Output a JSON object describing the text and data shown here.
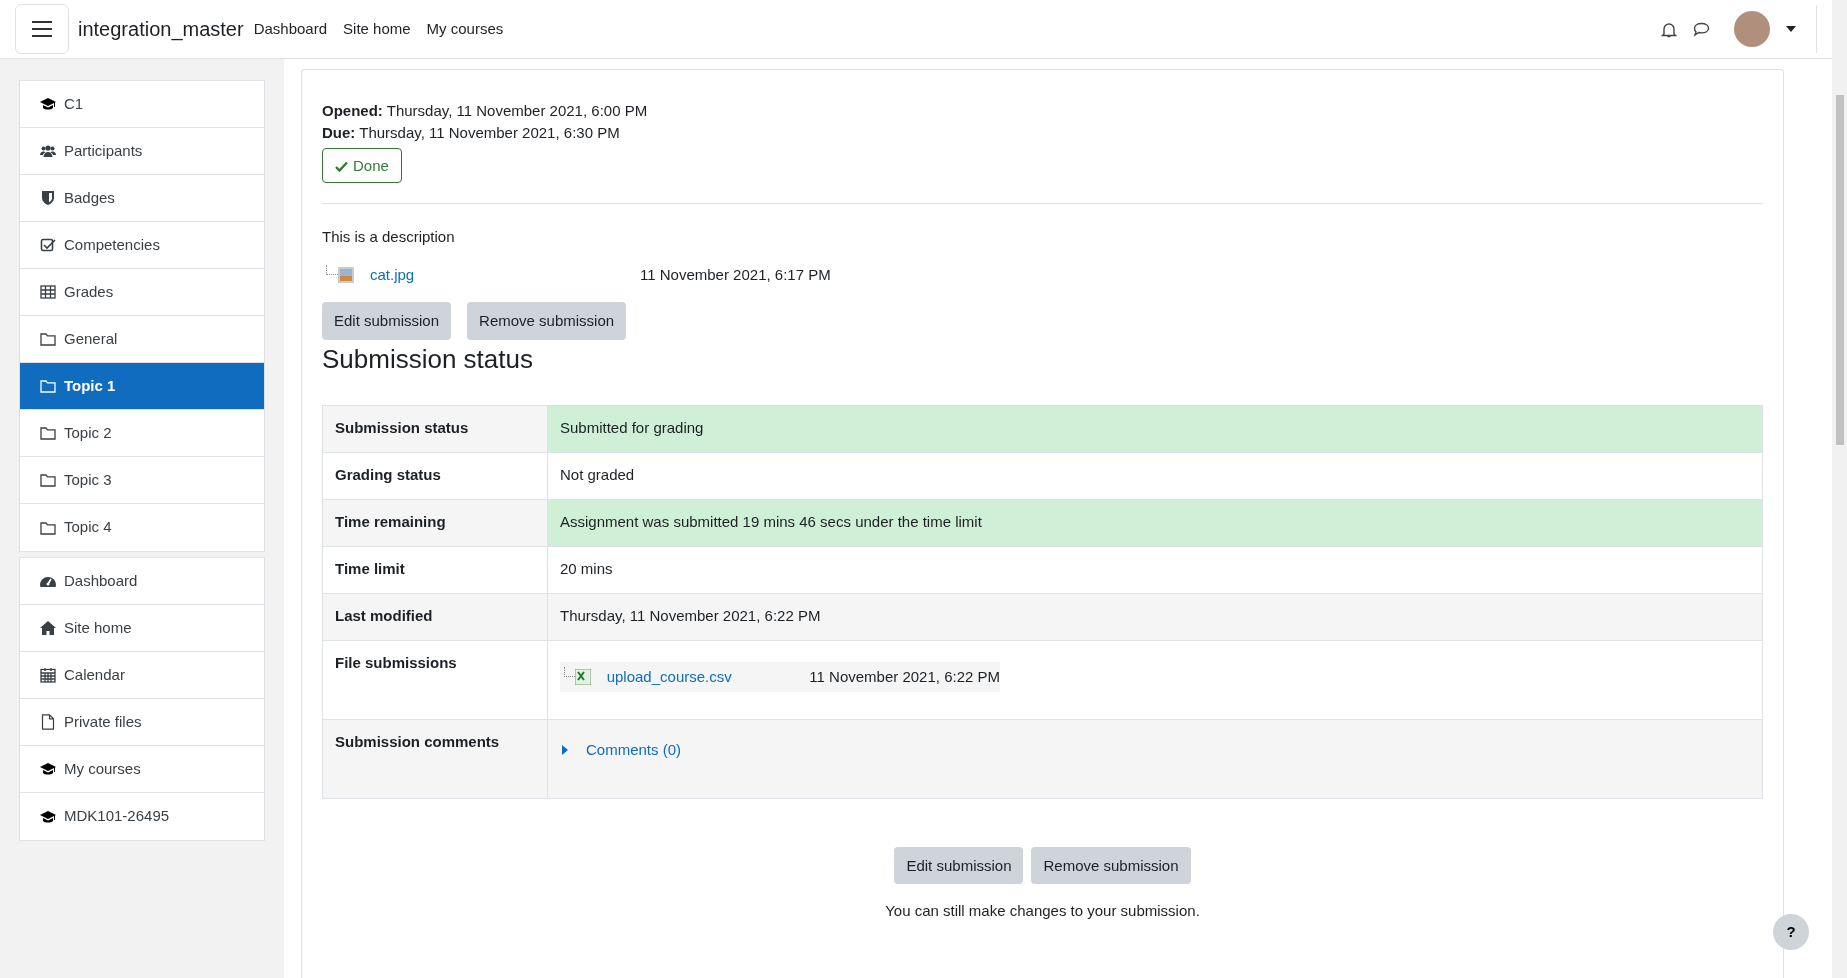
{
  "navbar": {
    "site_name": "integration_master",
    "links": [
      {
        "label": "Dashboard"
      },
      {
        "label": "Site home"
      },
      {
        "label": "My courses"
      }
    ]
  },
  "sidebar": {
    "groups": [
      [
        {
          "label": "C1",
          "kind": "course",
          "selected": false
        },
        {
          "label": "Participants",
          "kind": "participants",
          "selected": false
        },
        {
          "label": "Badges",
          "kind": "badges",
          "selected": false
        },
        {
          "label": "Competencies",
          "kind": "competencies",
          "selected": false
        },
        {
          "label": "Grades",
          "kind": "grades",
          "selected": false
        },
        {
          "label": "General",
          "kind": "section",
          "selected": false
        },
        {
          "label": "Topic 1",
          "kind": "section",
          "selected": true
        },
        {
          "label": "Topic 2",
          "kind": "section",
          "selected": false
        },
        {
          "label": "Topic 3",
          "kind": "section",
          "selected": false
        },
        {
          "label": "Topic 4",
          "kind": "section",
          "selected": false
        }
      ],
      [
        {
          "label": "Dashboard",
          "kind": "dashboard",
          "selected": false
        },
        {
          "label": "Site home",
          "kind": "home",
          "selected": false
        },
        {
          "label": "Calendar",
          "kind": "calendar",
          "selected": false
        },
        {
          "label": "Private files",
          "kind": "files",
          "selected": false
        },
        {
          "label": "My courses",
          "kind": "course",
          "selected": false
        },
        {
          "label": "MDK101-26495",
          "kind": "course",
          "selected": false
        }
      ]
    ]
  },
  "dates": [
    {
      "label": "Opened:",
      "value": "Thursday, 11 November 2021, 6:00 PM"
    },
    {
      "label": "Due:",
      "value": "Thursday, 11 November 2021, 6:30 PM"
    }
  ],
  "done_button": "Done",
  "description": "This is a description",
  "attachment": {
    "name": "cat.jpg",
    "date": "11 November 2021, 6:17 PM"
  },
  "top_buttons": [
    "Edit submission",
    "Remove submission"
  ],
  "heading": "Submission status",
  "status_rows": [
    {
      "label": "Submission status",
      "kind": "text",
      "value": "Submitted for grading",
      "highlight": true
    },
    {
      "label": "Grading status",
      "kind": "text",
      "value": "Not graded",
      "highlight": false
    },
    {
      "label": "Time remaining",
      "kind": "text",
      "value": "Assignment was submitted 19 mins 46 secs under the time limit",
      "highlight": true
    },
    {
      "label": "Time limit",
      "kind": "text",
      "value": "20 mins",
      "highlight": false
    },
    {
      "label": "Last modified",
      "kind": "text",
      "value": "Thursday, 11 November 2021, 6:22 PM",
      "highlight": false
    },
    {
      "label": "File submissions",
      "kind": "file",
      "value": "upload_course.csv",
      "date": "11 November 2021, 6:22 PM",
      "highlight": false
    },
    {
      "label": "Submission comments",
      "kind": "comments",
      "value": "Comments (0)",
      "expanded": false,
      "highlight": false
    }
  ],
  "bottom_buttons": [
    "Edit submission",
    "Remove submission"
  ],
  "note": "You can still make changes to your submission.",
  "help_button": "?"
}
